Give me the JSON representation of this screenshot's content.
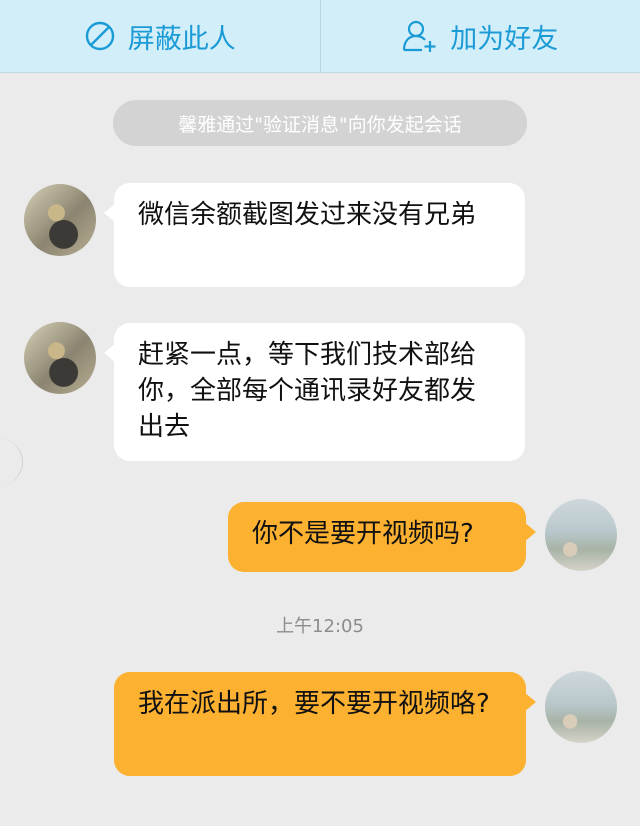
{
  "topbar": {
    "block_label": "屏蔽此人",
    "add_friend_label": "加为好友",
    "accent_color": "#1b9bd6",
    "background_color": "#d2eef9",
    "block_icon": "block-icon",
    "add_friend_icon": "add-friend-icon"
  },
  "system_notice": "馨雅通过\"验证消息\"向你发起会话",
  "messages": [
    {
      "direction": "incoming",
      "text": "微信余额截图发过来没有兄弟"
    },
    {
      "direction": "incoming",
      "text": "赶紧一点，等下我们技术部给你，全部每个通讯录好友都发出去"
    },
    {
      "direction": "outgoing",
      "text": "你不是要开视频吗?"
    },
    {
      "direction": "outgoing",
      "text": "我在派出所，要不要开视频咯?"
    }
  ],
  "timestamp": "上午12:05",
  "colors": {
    "incoming_bubble": "#ffffff",
    "outgoing_bubble": "#fcb131",
    "chat_background": "#ebebeb"
  }
}
